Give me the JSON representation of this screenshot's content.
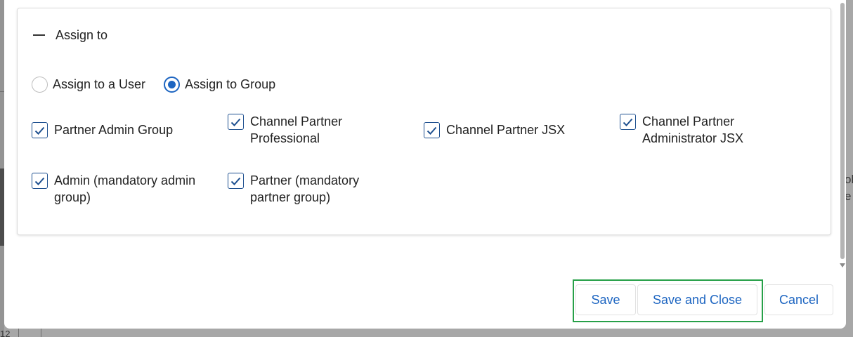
{
  "background": {
    "right_text_lines": [
      "ol",
      "e"
    ],
    "bottom_number": "12"
  },
  "panel": {
    "title": "Assign to"
  },
  "assign_options": [
    {
      "label": "Assign to a User",
      "selected": false
    },
    {
      "label": "Assign to Group",
      "selected": true
    }
  ],
  "groups": [
    {
      "lines": [
        "Partner Admin Group",
        ""
      ],
      "checked": true
    },
    {
      "lines": [
        "Channel Partner",
        "Professional"
      ],
      "checked": true
    },
    {
      "lines": [
        "Channel Partner JSX",
        ""
      ],
      "checked": true
    },
    {
      "lines": [
        "Channel Partner",
        "Administrator JSX"
      ],
      "checked": true
    },
    {
      "lines": [
        "Admin (mandatory admin",
        "group)"
      ],
      "checked": true
    },
    {
      "lines": [
        "Partner (mandatory",
        "partner group)"
      ],
      "checked": true
    }
  ],
  "actions": {
    "save_label": "Save",
    "save_close_label": "Save and Close",
    "cancel_label": "Cancel"
  },
  "colors": {
    "accent": "#1d65c1",
    "highlight": "#27a048",
    "checkbox_border": "#1d4f8f"
  }
}
